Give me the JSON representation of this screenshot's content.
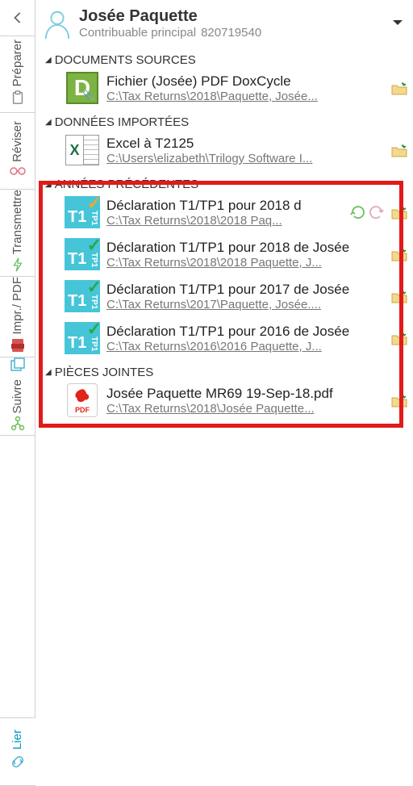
{
  "header": {
    "name": "Josée Paquette",
    "role": "Contribuable principal",
    "id": "820719540"
  },
  "tabs": {
    "preparer": "Préparer",
    "reviser": "Réviser",
    "transmettre": "Transmettre",
    "pdf": "PDF",
    "impr": "Impr./",
    "suivre": "Suivre",
    "lier": "Lier"
  },
  "sections": {
    "documents_sources": "DOCUMENTS SOURCES",
    "donnees_importees": "DONNÉES IMPORTÉES",
    "annees_precedentes": "ANNÉES PRÉCÉDENTES",
    "pieces_jointes": "PIÈCES JOINTES"
  },
  "items": {
    "dox": {
      "title": "Fichier (Josée) PDF DoxCycle",
      "path": "C:\\Tax Returns\\2018\\Paquette, Josée..."
    },
    "excel": {
      "title": "Excel à T2125",
      "path": "C:\\Users\\elizabeth\\Trilogy Software I..."
    },
    "y1": {
      "title": "Déclaration T1/TP1 pour 2018 d",
      "path": "C:\\Tax Returns\\2018\\2018 Paq..."
    },
    "y2": {
      "title": "Déclaration T1/TP1 pour 2018 de Josée",
      "path": "C:\\Tax Returns\\2018\\2018 Paquette, J..."
    },
    "y3": {
      "title": "Déclaration T1/TP1 pour 2017 de Josée",
      "path": "C:\\Tax Returns\\2017\\Paquette, Josée...."
    },
    "y4": {
      "title": "Déclaration T1/TP1 pour 2016 de Josée",
      "path": "C:\\Tax Returns\\2016\\2016 Paquette, J..."
    },
    "pdf": {
      "title": "Josée Paquette MR69  19-Sep-18.pdf",
      "path": "C:\\Tax Returns\\2018\\Josée Paquette..."
    }
  }
}
